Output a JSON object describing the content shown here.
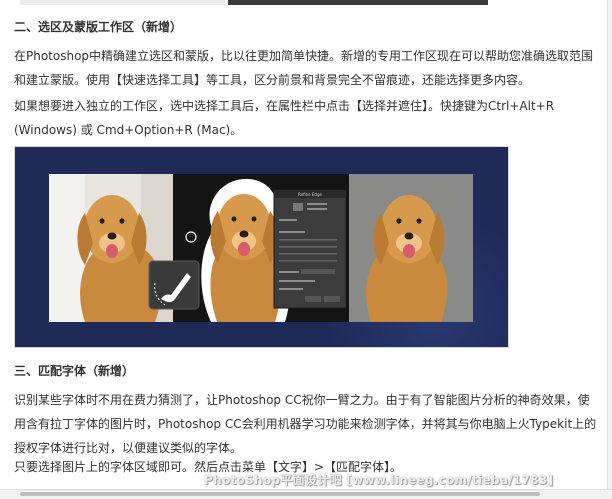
{
  "section2": {
    "heading": "二、选区及蒙版工作区（新增）",
    "para1": "在Photoshop中精确建立选区和蒙版，比以往更加简单快捷。新增的专用工作区现在可以帮助您准确选取范围和建立蒙版。使用【快速选择工具】等工具，区分前景和背景完全不留痕迹，还能选择更多内容。",
    "para2": "如果想要进入独立的工作区，选中选择工具后，在属性栏中点击【选择并遮住】。快捷键为Ctrl+Alt+R (Windows) 或 Cmd+Option+R (Mac)。"
  },
  "dialog": {
    "title": "Refine Edge"
  },
  "section3": {
    "heading": "三、匹配字体（新增）",
    "para1": "识别某些字体时不用在费力猜测了，让Photoshop CC祝你一臂之力。由于有了智能图片分析的神奇效果，使用含有拉丁字体的图片时，Photoshop CC会利用机器学习功能来检测字体，并将其与你电脑上火Typekit上的授权字体进行比对，以便建议类似的字体。",
    "para2": "只要选择图片上的字体区域即可。然后点击菜单【文字】>【匹配字体】。"
  },
  "watermark": "PhotoShop平面设计吧 [www.lineeg.com/tieba/1783]",
  "colors": {
    "figure_bg": "#1e2a58",
    "text": "#333333"
  }
}
